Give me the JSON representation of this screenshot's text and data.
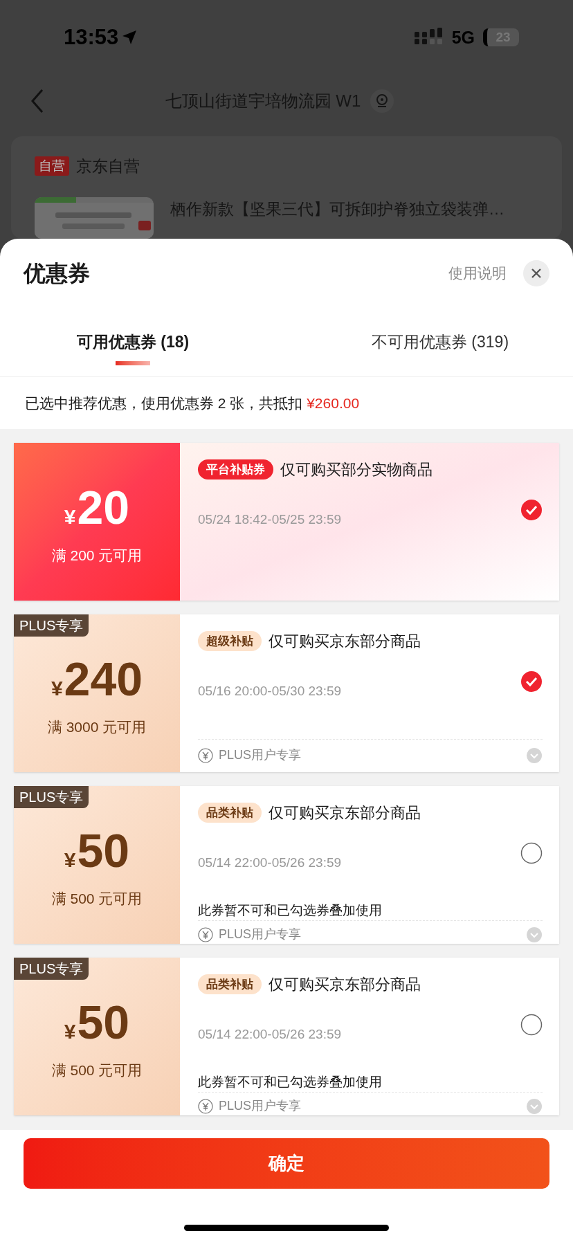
{
  "status_bar": {
    "time": "13:53",
    "network": "5G",
    "battery": "23"
  },
  "background_page": {
    "nav_title": "七顶山街道宇培物流园 W1",
    "store_badge": "自营",
    "store_name": "京东自营",
    "product_title": "栖作新款【坚果三代】可拆卸护脊独立袋装弹…"
  },
  "sheet": {
    "title": "优惠券",
    "help_link": "使用说明",
    "tabs": [
      {
        "label": "可用优惠券 (18)",
        "selected": true
      },
      {
        "label": "不可用优惠券 (319)",
        "selected": false
      }
    ],
    "summary": {
      "text": "已选中推荐优惠，使用优惠券 2 张，共抵扣 ",
      "amount": "¥260.00"
    },
    "coupons": [
      {
        "kind": "platform",
        "currency": "¥",
        "amount": "20",
        "threshold": "满 200 元可用",
        "tag": "平台补贴券",
        "description": "仅可购买部分实物商品",
        "validity": "05/24 18:42-05/25 23:59",
        "selected": true
      },
      {
        "kind": "plus",
        "plus_tag": "PLUS专享",
        "currency": "¥",
        "amount": "240",
        "threshold": "满 3000 元可用",
        "tag": "超级补贴",
        "description": "仅可购买京东部分商品",
        "validity": "05/16 20:00-05/30 23:59",
        "footer": "PLUS用户专享",
        "selected": true
      },
      {
        "kind": "plus",
        "plus_tag": "PLUS专享",
        "currency": "¥",
        "amount": "50",
        "threshold": "满 500 元可用",
        "tag": "品类补贴",
        "description": "仅可购买京东部分商品",
        "validity": "05/14 22:00-05/26 23:59",
        "note": "此券暂不可和已勾选券叠加使用",
        "footer": "PLUS用户专享",
        "selected": false
      },
      {
        "kind": "plus",
        "plus_tag": "PLUS专享",
        "currency": "¥",
        "amount": "50",
        "threshold": "满 500 元可用",
        "tag": "品类补贴",
        "description": "仅可购买京东部分商品",
        "validity": "05/14 22:00-05/26 23:59",
        "note": "此券暂不可和已勾选券叠加使用",
        "footer": "PLUS用户专享",
        "selected": false
      }
    ],
    "confirm_button": "确定"
  }
}
